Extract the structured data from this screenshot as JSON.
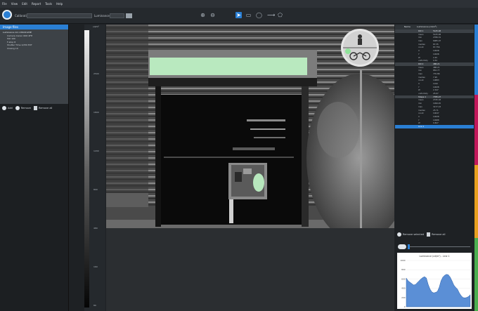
{
  "menu": [
    "File",
    "View",
    "Edit",
    "Report",
    "Tools",
    "Help"
  ],
  "toolbar": {
    "calibration_label": "Calibration",
    "luminance_label": "Luminance"
  },
  "left_panel": {
    "title": "Image files",
    "files": [
      "Luminance 12.1 DSC0123E",
      "Camera Canon 60D 4FH",
      "ISO 100",
      "F-stop 8",
      "Shutter Time 1/250 EXT",
      "Closing 10"
    ],
    "buttons": {
      "add": "Add",
      "remove": "Remove",
      "remove_all": "Remove all"
    }
  },
  "scale": {
    "unit": "cd/m²",
    "ticks": [
      "2500",
      "1800",
      "1200",
      "800",
      "480",
      "160",
      "80"
    ]
  },
  "right_panel": {
    "col_name": "Name",
    "col_value": "Luminance (cd/m²)",
    "groups": [
      {
        "label": "ROI 1",
        "value": "5125.48",
        "rows": [
          [
            "mean",
            "5125.48"
          ],
          [
            "min",
            "2786.31"
          ],
          [
            "max",
            "6985.07"
          ],
          [
            "median",
            "87.35"
          ],
          [
            "count",
            "87.756"
          ],
          [
            "X",
            "10938"
          ],
          [
            "Y",
            "10938"
          ],
          [
            "W",
            "2.45"
          ],
          [
            "uniformity",
            "0.54"
          ]
        ]
      },
      {
        "label": "ROI 2",
        "value": "488.21",
        "rows": [
          [
            "mean",
            "488.21"
          ],
          [
            "min",
            "852.77"
          ],
          [
            "max",
            "770.86"
          ],
          [
            "median",
            "7.95"
          ],
          [
            "count",
            "10883"
          ],
          [
            "X",
            "1010"
          ],
          [
            "Y",
            "10938"
          ],
          [
            "W",
            "2.347"
          ],
          [
            "uniformity",
            "25.67"
          ]
        ]
      },
      {
        "label": "Shape 1",
        "value": "7785.27",
        "rows": [
          [
            "mean",
            "2745.18"
          ],
          [
            "min",
            "1999.45"
          ],
          [
            "max",
            "3177.23"
          ],
          [
            "median",
            "25.71"
          ],
          [
            "count",
            "10047"
          ],
          [
            "X",
            "10938"
          ],
          [
            "Y",
            "10988"
          ],
          [
            "W",
            "0.827"
          ]
        ]
      }
    ],
    "selected_row": "Line 1",
    "buttons": {
      "remove_selected": "Remove selected",
      "remove_all": "Remove all"
    },
    "chart_title": "Luminance (cd/m²) - Line 1",
    "colors": [
      "#2a7fd4",
      "#c2185b",
      "#e8a020",
      "#4caf50"
    ]
  },
  "chart_data": {
    "type": "area",
    "title": "Luminance (cd/m²) - Line 1",
    "xlabel": "",
    "ylabel": "",
    "ylim": [
      0,
      1000
    ],
    "y_ticks": [
      "1000",
      "800",
      "600",
      "400",
      "200",
      "0"
    ],
    "values": [
      620,
      560,
      530,
      500,
      470,
      480,
      520,
      560,
      600,
      630,
      650,
      620,
      480,
      380,
      320,
      300,
      310,
      330,
      420,
      560,
      640,
      680,
      700,
      690,
      640,
      560,
      470,
      420,
      380,
      300,
      240,
      200,
      190,
      200,
      220,
      260
    ]
  }
}
